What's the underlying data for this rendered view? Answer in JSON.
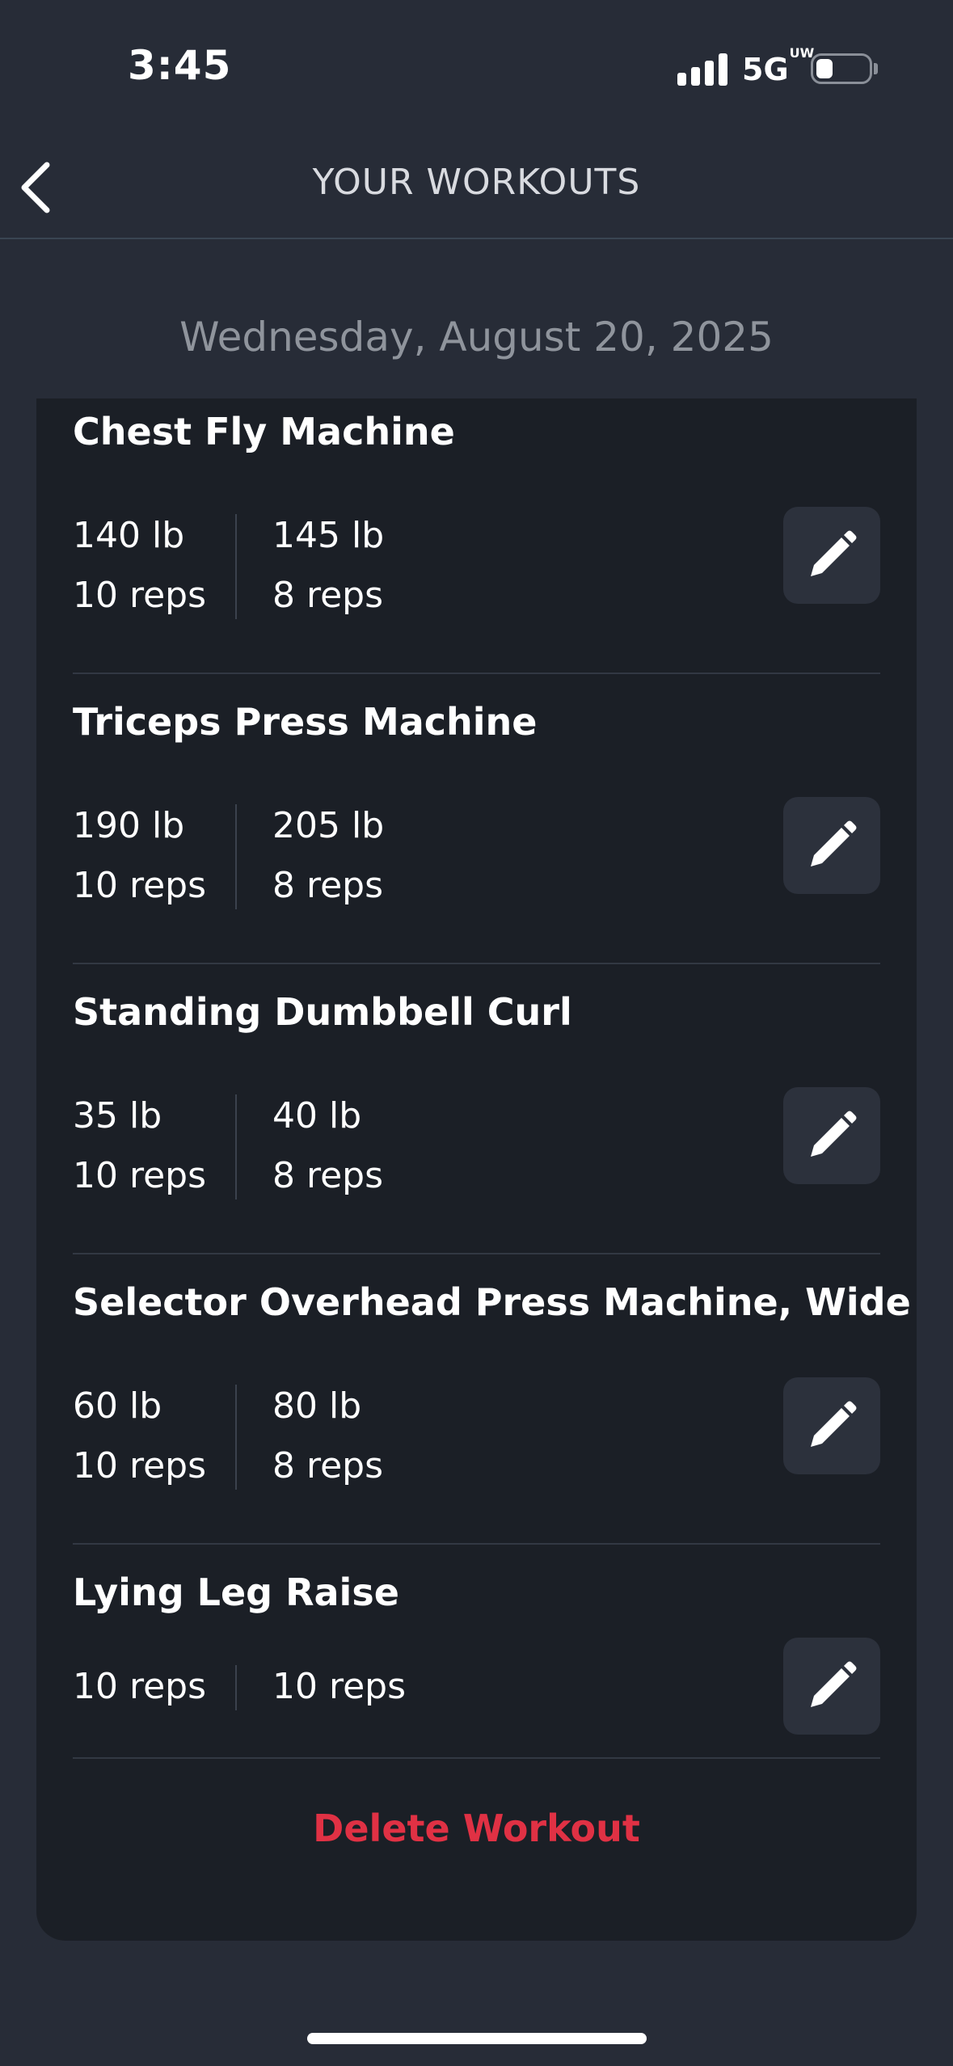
{
  "status_bar": {
    "time": "3:45",
    "network": "5G",
    "network_suffix": "UW",
    "icons": [
      "signal-icon",
      "battery-icon"
    ]
  },
  "nav": {
    "title": "YOUR WORKOUTS",
    "back_icon": "chevron-left-icon"
  },
  "date": "Wednesday, August 20, 2025",
  "exercises": [
    {
      "name": "Chest Fly Machine",
      "sets": [
        {
          "weight": "140 lb",
          "reps": "10 reps"
        },
        {
          "weight": "145 lb",
          "reps": "8 reps"
        }
      ]
    },
    {
      "name": "Triceps Press Machine",
      "sets": [
        {
          "weight": "190 lb",
          "reps": "10 reps"
        },
        {
          "weight": "205 lb",
          "reps": "8 reps"
        }
      ]
    },
    {
      "name": "Standing Dumbbell Curl",
      "sets": [
        {
          "weight": "35 lb",
          "reps": "10 reps"
        },
        {
          "weight": "40 lb",
          "reps": "8 reps"
        }
      ]
    },
    {
      "name": "Selector Overhead Press Machine, Wide",
      "sets": [
        {
          "weight": "60 lb",
          "reps": "10 reps"
        },
        {
          "weight": "80 lb",
          "reps": "8 reps"
        }
      ]
    },
    {
      "name": "Lying Leg Raise",
      "sets": [
        {
          "reps": "10 reps"
        },
        {
          "reps": "10 reps"
        }
      ]
    }
  ],
  "edit_icon": "pencil-icon",
  "delete_label": "Delete Workout",
  "colors": {
    "background": "#272c37",
    "card": "#1b1f26",
    "delete": "#e03144"
  }
}
